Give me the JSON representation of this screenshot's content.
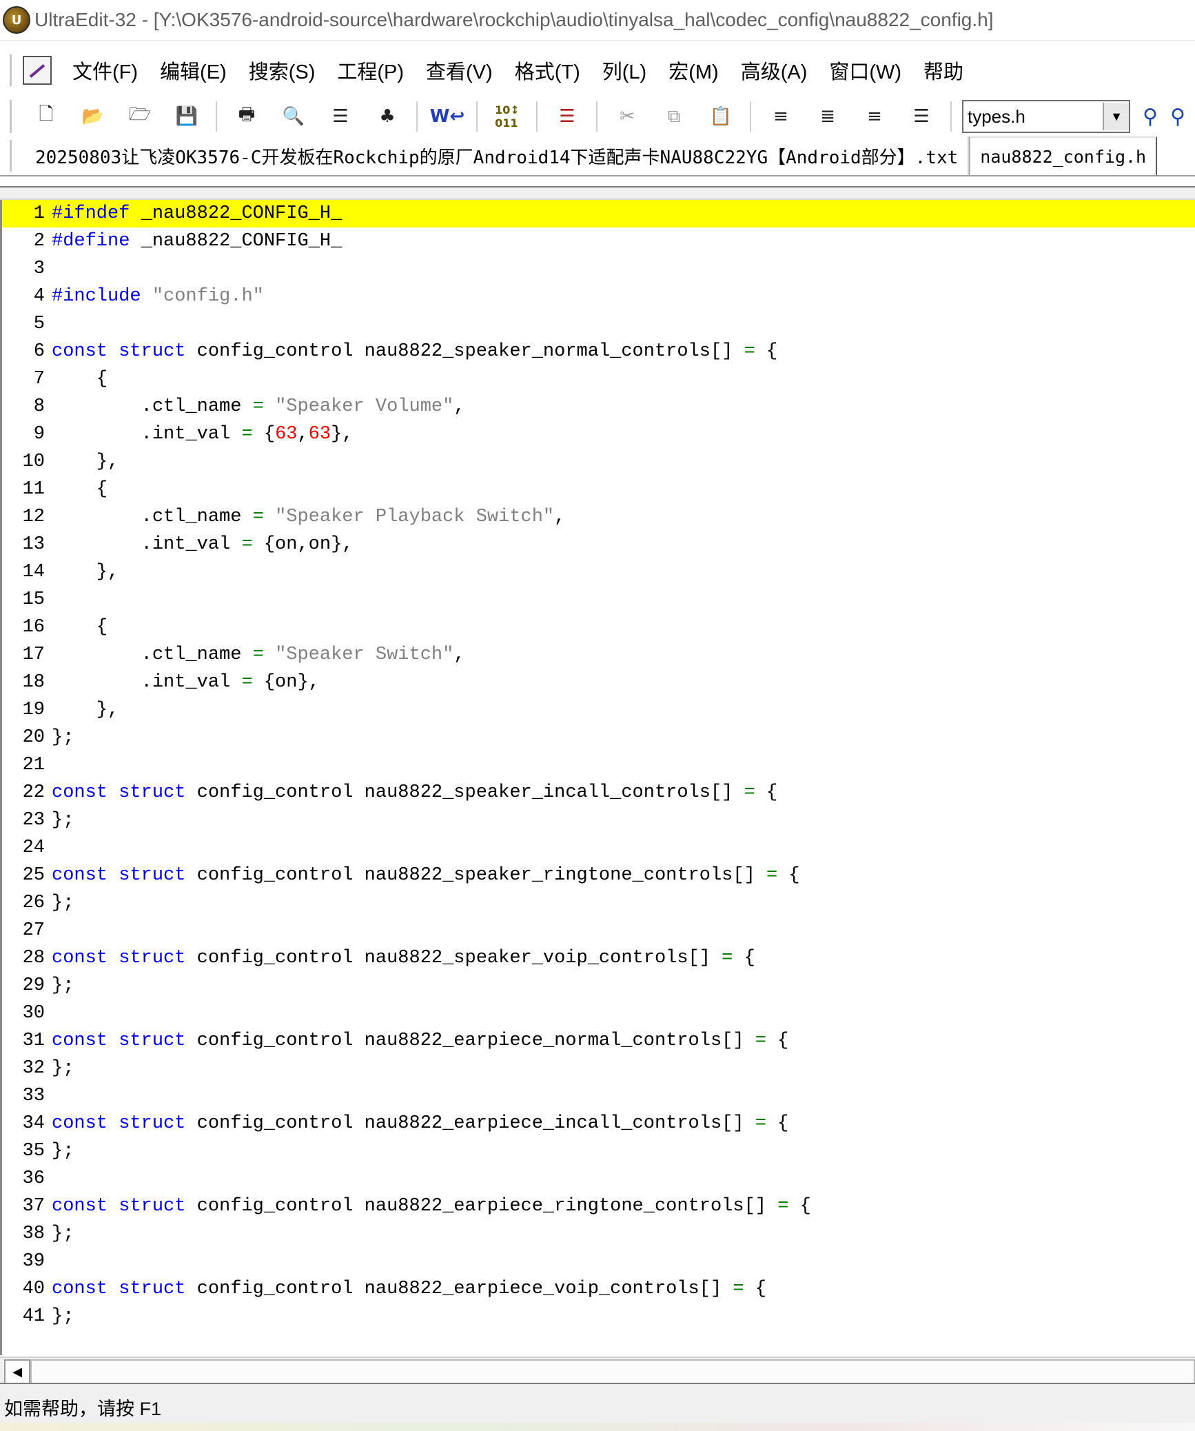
{
  "window": {
    "title": "UltraEdit-32 - [Y:\\OK3576-android-source\\hardware\\rockchip\\audio\\tinyalsa_hal\\codec_config\\nau8822_config.h]",
    "app_icon_letter": "U"
  },
  "menubar": {
    "items": [
      "文件(F)",
      "编辑(E)",
      "搜索(S)",
      "工程(P)",
      "查看(V)",
      "格式(T)",
      "列(L)",
      "宏(M)",
      "高级(A)",
      "窗口(W)",
      "帮助"
    ]
  },
  "toolbar": {
    "combo_value": "types.h",
    "combo_arrow": "▼",
    "icons": [
      "new-file-icon",
      "open-file-icon",
      "open-folder-icon",
      "save-icon",
      "print-icon",
      "print-preview-icon",
      "column-icon",
      "tree-icon",
      "word-wrap-icon",
      "hex-icon",
      "format-icon",
      "cut-icon",
      "copy-icon",
      "paste-icon",
      "align-left-icon",
      "align-center-icon",
      "align-right-icon",
      "justify-icon",
      "find-icon",
      "find-next-icon"
    ]
  },
  "tabs": [
    {
      "label": "20250803让飞凌OK3576-C开发板在Rockchip的原厂Android14下适配声卡NAU88C22YG【Android部分】.txt",
      "active": false
    },
    {
      "label": "nau8822_config.h",
      "active": true
    }
  ],
  "editor": {
    "current_line": 1,
    "lines": [
      {
        "n": "1",
        "tokens": [
          [
            "pre",
            "#ifndef"
          ],
          [
            "t",
            " _nau8822_CONFIG_H_"
          ]
        ]
      },
      {
        "n": "2",
        "tokens": [
          [
            "pre",
            "#define"
          ],
          [
            "t",
            " _nau8822_CONFIG_H_"
          ]
        ]
      },
      {
        "n": "3",
        "tokens": []
      },
      {
        "n": "4",
        "tokens": [
          [
            "pre",
            "#include"
          ],
          [
            "t",
            " "
          ],
          [
            "str",
            "\"config.h\""
          ]
        ]
      },
      {
        "n": "5",
        "tokens": []
      },
      {
        "n": "6",
        "tokens": [
          [
            "kw",
            "const"
          ],
          [
            "t",
            " "
          ],
          [
            "kw",
            "struct"
          ],
          [
            "t",
            " config_control nau8822_speaker_normal_controls[] "
          ],
          [
            "op",
            "="
          ],
          [
            "t",
            " {"
          ]
        ]
      },
      {
        "n": "7",
        "tokens": [
          [
            "t",
            "    {"
          ]
        ]
      },
      {
        "n": "8",
        "tokens": [
          [
            "t",
            "        .ctl_name "
          ],
          [
            "op",
            "="
          ],
          [
            "t",
            " "
          ],
          [
            "str",
            "\"Speaker Volume\""
          ],
          [
            "t",
            ","
          ]
        ]
      },
      {
        "n": "9",
        "tokens": [
          [
            "t",
            "        .int_val "
          ],
          [
            "op",
            "="
          ],
          [
            "t",
            " {"
          ],
          [
            "num",
            "63"
          ],
          [
            "t",
            ","
          ],
          [
            "num",
            "63"
          ],
          [
            "t",
            "},"
          ]
        ]
      },
      {
        "n": "10",
        "tokens": [
          [
            "t",
            "    },"
          ]
        ]
      },
      {
        "n": "11",
        "tokens": [
          [
            "t",
            "    {"
          ]
        ]
      },
      {
        "n": "12",
        "tokens": [
          [
            "t",
            "        .ctl_name "
          ],
          [
            "op",
            "="
          ],
          [
            "t",
            " "
          ],
          [
            "str",
            "\"Speaker Playback Switch\""
          ],
          [
            "t",
            ","
          ]
        ]
      },
      {
        "n": "13",
        "tokens": [
          [
            "t",
            "        .int_val "
          ],
          [
            "op",
            "="
          ],
          [
            "t",
            " {on,on},"
          ]
        ]
      },
      {
        "n": "14",
        "tokens": [
          [
            "t",
            "    },"
          ]
        ]
      },
      {
        "n": "15",
        "tokens": []
      },
      {
        "n": "16",
        "tokens": [
          [
            "t",
            "    {"
          ]
        ]
      },
      {
        "n": "17",
        "tokens": [
          [
            "t",
            "        .ctl_name "
          ],
          [
            "op",
            "="
          ],
          [
            "t",
            " "
          ],
          [
            "str",
            "\"Speaker Switch\""
          ],
          [
            "t",
            ","
          ]
        ]
      },
      {
        "n": "18",
        "tokens": [
          [
            "t",
            "        .int_val "
          ],
          [
            "op",
            "="
          ],
          [
            "t",
            " {on},"
          ]
        ]
      },
      {
        "n": "19",
        "tokens": [
          [
            "t",
            "    },"
          ]
        ]
      },
      {
        "n": "20",
        "tokens": [
          [
            "t",
            "};"
          ]
        ]
      },
      {
        "n": "21",
        "tokens": []
      },
      {
        "n": "22",
        "tokens": [
          [
            "kw",
            "const"
          ],
          [
            "t",
            " "
          ],
          [
            "kw",
            "struct"
          ],
          [
            "t",
            " config_control nau8822_speaker_incall_controls[] "
          ],
          [
            "op",
            "="
          ],
          [
            "t",
            " {"
          ]
        ]
      },
      {
        "n": "23",
        "tokens": [
          [
            "t",
            "};"
          ]
        ]
      },
      {
        "n": "24",
        "tokens": []
      },
      {
        "n": "25",
        "tokens": [
          [
            "kw",
            "const"
          ],
          [
            "t",
            " "
          ],
          [
            "kw",
            "struct"
          ],
          [
            "t",
            " config_control nau8822_speaker_ringtone_controls[] "
          ],
          [
            "op",
            "="
          ],
          [
            "t",
            " {"
          ]
        ]
      },
      {
        "n": "26",
        "tokens": [
          [
            "t",
            "};"
          ]
        ]
      },
      {
        "n": "27",
        "tokens": []
      },
      {
        "n": "28",
        "tokens": [
          [
            "kw",
            "const"
          ],
          [
            "t",
            " "
          ],
          [
            "kw",
            "struct"
          ],
          [
            "t",
            " config_control nau8822_speaker_voip_controls[] "
          ],
          [
            "op",
            "="
          ],
          [
            "t",
            " {"
          ]
        ]
      },
      {
        "n": "29",
        "tokens": [
          [
            "t",
            "};"
          ]
        ]
      },
      {
        "n": "30",
        "tokens": []
      },
      {
        "n": "31",
        "tokens": [
          [
            "kw",
            "const"
          ],
          [
            "t",
            " "
          ],
          [
            "kw",
            "struct"
          ],
          [
            "t",
            " config_control nau8822_earpiece_normal_controls[] "
          ],
          [
            "op",
            "="
          ],
          [
            "t",
            " {"
          ]
        ]
      },
      {
        "n": "32",
        "tokens": [
          [
            "t",
            "};"
          ]
        ]
      },
      {
        "n": "33",
        "tokens": []
      },
      {
        "n": "34",
        "tokens": [
          [
            "kw",
            "const"
          ],
          [
            "t",
            " "
          ],
          [
            "kw",
            "struct"
          ],
          [
            "t",
            " config_control nau8822_earpiece_incall_controls[] "
          ],
          [
            "op",
            "="
          ],
          [
            "t",
            " {"
          ]
        ]
      },
      {
        "n": "35",
        "tokens": [
          [
            "t",
            "};"
          ]
        ]
      },
      {
        "n": "36",
        "tokens": []
      },
      {
        "n": "37",
        "tokens": [
          [
            "kw",
            "const"
          ],
          [
            "t",
            " "
          ],
          [
            "kw",
            "struct"
          ],
          [
            "t",
            " config_control nau8822_earpiece_ringtone_controls[] "
          ],
          [
            "op",
            "="
          ],
          [
            "t",
            " {"
          ]
        ]
      },
      {
        "n": "38",
        "tokens": [
          [
            "t",
            "};"
          ]
        ]
      },
      {
        "n": "39",
        "tokens": []
      },
      {
        "n": "40",
        "tokens": [
          [
            "kw",
            "const"
          ],
          [
            "t",
            " "
          ],
          [
            "kw",
            "struct"
          ],
          [
            "t",
            " config_control nau8822_earpiece_voip_controls[] "
          ],
          [
            "op",
            "="
          ],
          [
            "t",
            " {"
          ]
        ]
      },
      {
        "n": "41",
        "tokens": [
          [
            "t",
            "};"
          ]
        ]
      }
    ]
  },
  "statusbar": {
    "text": "如需帮助，请按 F1"
  },
  "hscroll": {
    "left_arrow": "◀"
  },
  "colors": {
    "current_line": "#ffff00",
    "keyword": "#0000ff",
    "string": "#808080",
    "number": "#ff0000",
    "operator": "#008000"
  }
}
